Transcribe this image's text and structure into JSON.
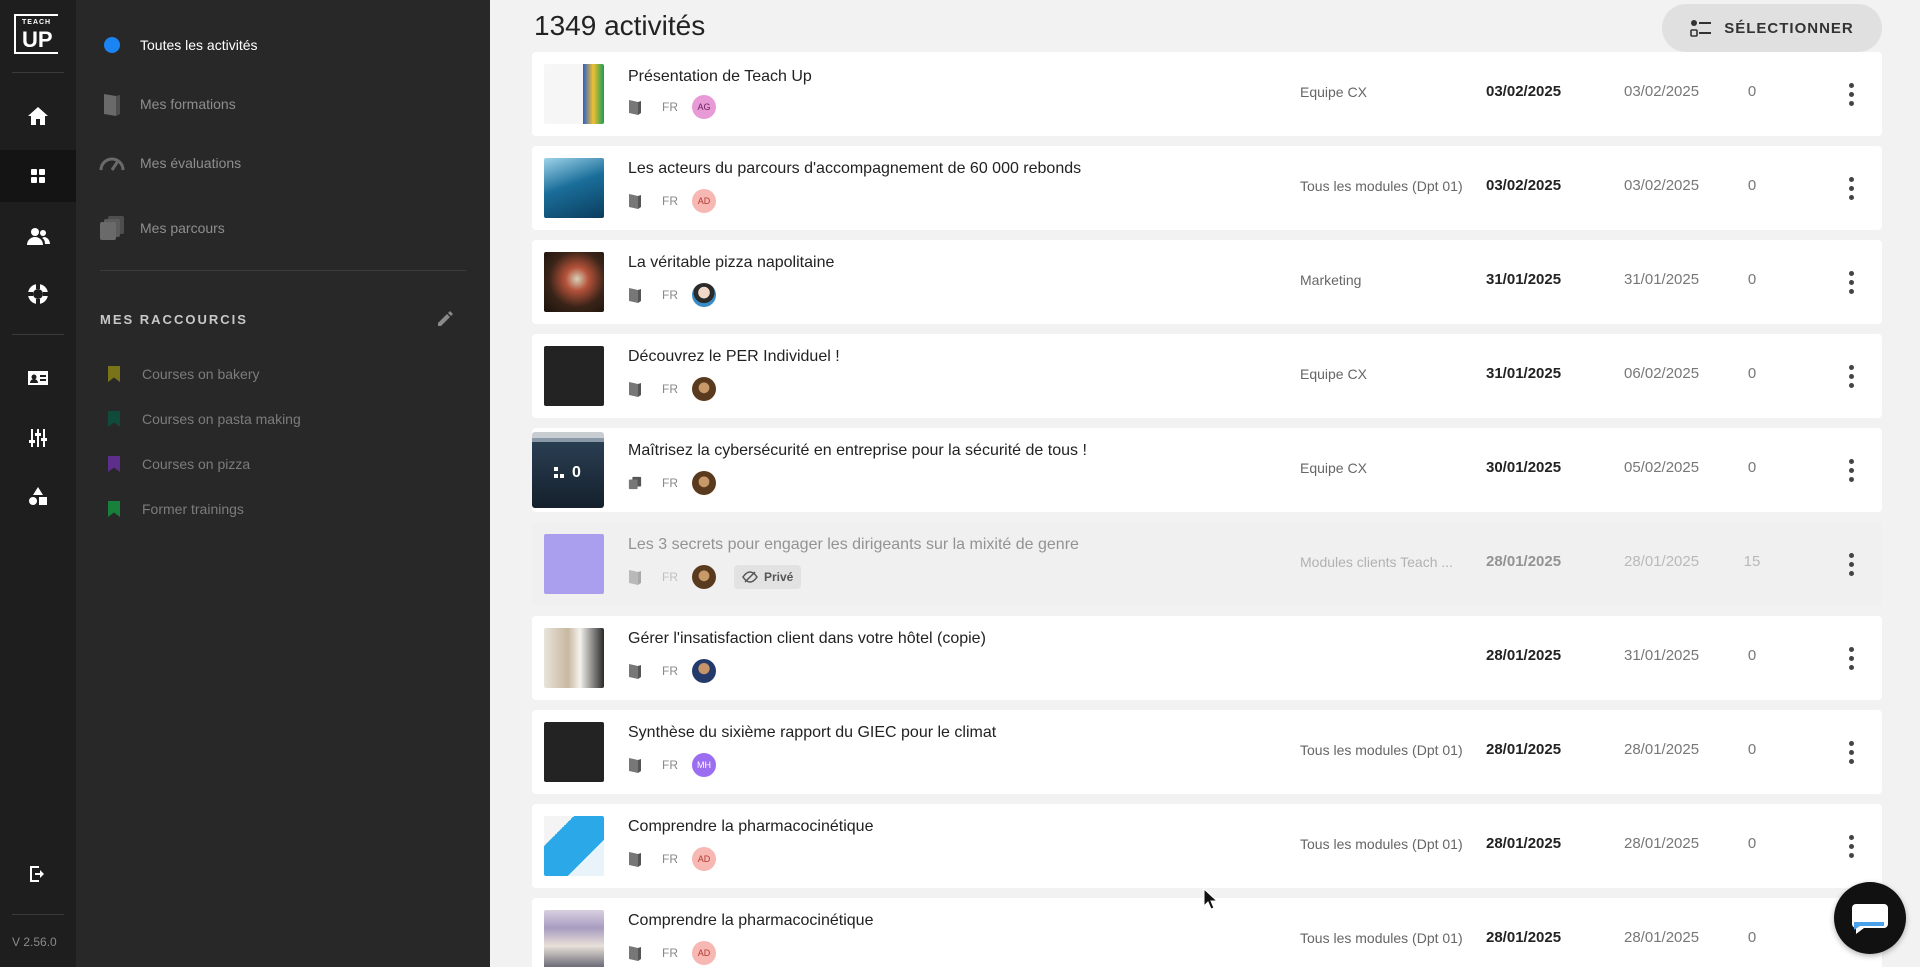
{
  "brand": {
    "logo_top": "TEACH",
    "logo_main": "UP"
  },
  "version": "V 2.56.0",
  "rail": {
    "icons": [
      "home-icon",
      "grid-icon",
      "users-icon",
      "lifebuoy-icon",
      "id-card-icon",
      "sliders-icon",
      "shapes-icon"
    ],
    "active": "grid-icon",
    "logout": "logout-icon"
  },
  "menu": {
    "items": [
      {
        "label": "Toutes les activités",
        "icon": "dot-icon",
        "active": true
      },
      {
        "label": "Mes formations",
        "icon": "book-icon",
        "active": false
      },
      {
        "label": "Mes évaluations",
        "icon": "gauge-icon",
        "active": false
      },
      {
        "label": "Mes parcours",
        "icon": "stack-icon",
        "active": false
      }
    ]
  },
  "shortcuts": {
    "title": "MES RACCOURCIS",
    "items": [
      {
        "label": "Courses on bakery",
        "color": "#7a7418"
      },
      {
        "label": "Courses on pasta making",
        "color": "#0f4a3a"
      },
      {
        "label": "Courses on pizza",
        "color": "#5d2e8c"
      },
      {
        "label": "Former trainings",
        "color": "#17803a"
      }
    ]
  },
  "header": {
    "count_title": "1349 activités",
    "select_label": "SÉLECTIONNER"
  },
  "rows": [
    {
      "title": "Présentation de Teach Up",
      "lang": "FR",
      "avatar": "AG",
      "avatar_bg": "#e79ad6",
      "avatar_fg": "#6a1f5c",
      "team": "Equipe CX",
      "date1": "03/02/2025",
      "date2": "03/02/2025",
      "count": "0"
    },
    {
      "title": "Les acteurs du parcours d'accompagnement de 60 000 rebonds",
      "lang": "FR",
      "avatar": "AD",
      "avatar_bg": "#f7b7b3",
      "avatar_fg": "#b03a30",
      "team": "Tous les modules (Dpt 01)",
      "date1": "03/02/2025",
      "date2": "03/02/2025",
      "count": "0"
    },
    {
      "title": "La véritable pizza napolitaine",
      "lang": "FR",
      "avatar": "",
      "avatar_bg": "#3a8cc8",
      "avatar_fg": "#fff",
      "team": "Marketing",
      "date1": "31/01/2025",
      "date2": "31/01/2025",
      "count": "0"
    },
    {
      "title": "Découvrez le PER Individuel !",
      "lang": "FR",
      "avatar": "",
      "avatar_bg": "#6b4a2a",
      "avatar_fg": "#fff",
      "team": "Equipe CX",
      "date1": "31/01/2025",
      "date2": "06/02/2025",
      "count": "0"
    },
    {
      "title": "Maîtrisez la cybersécurité en entreprise pour la sécurité de tous !",
      "lang": "FR",
      "avatar": "",
      "avatar_bg": "#6b4a2a",
      "avatar_fg": "#fff",
      "team": "Equipe CX",
      "date1": "30/01/2025",
      "date2": "05/02/2025",
      "count": "0",
      "badge": "0"
    },
    {
      "title": "Les 3 secrets pour engager les dirigeants sur la mixité de genre",
      "lang": "FR",
      "avatar": "",
      "avatar_bg": "#6b4a2a",
      "avatar_fg": "#fff",
      "team": "Modules clients Teach ...",
      "date1": "28/01/2025",
      "date2": "28/01/2025",
      "count": "15",
      "private": "Privé"
    },
    {
      "title": "Gérer l'insatisfaction client dans votre hôtel (copie)",
      "lang": "FR",
      "avatar": "",
      "avatar_bg": "#243a6a",
      "avatar_fg": "#fff",
      "team": "",
      "date1": "28/01/2025",
      "date2": "31/01/2025",
      "count": "0"
    },
    {
      "title": "Synthèse du sixième rapport du GIEC pour le climat",
      "lang": "FR",
      "avatar": "MH",
      "avatar_bg": "#9b6df0",
      "avatar_fg": "#ffffff",
      "team": "Tous les modules (Dpt 01)",
      "date1": "28/01/2025",
      "date2": "28/01/2025",
      "count": "0"
    },
    {
      "title": "Comprendre la pharmacocinétique",
      "lang": "FR",
      "avatar": "AD",
      "avatar_bg": "#f7b7b3",
      "avatar_fg": "#b03a30",
      "team": "Tous les modules (Dpt 01)",
      "date1": "28/01/2025",
      "date2": "28/01/2025",
      "count": "0"
    },
    {
      "title": "Comprendre la pharmacocinétique",
      "lang": "FR",
      "avatar": "AD",
      "avatar_bg": "#f7b7b3",
      "avatar_fg": "#b03a30",
      "team": "Tous les modules (Dpt 01)",
      "date1": "28/01/2025",
      "date2": "28/01/2025",
      "count": "0"
    }
  ]
}
